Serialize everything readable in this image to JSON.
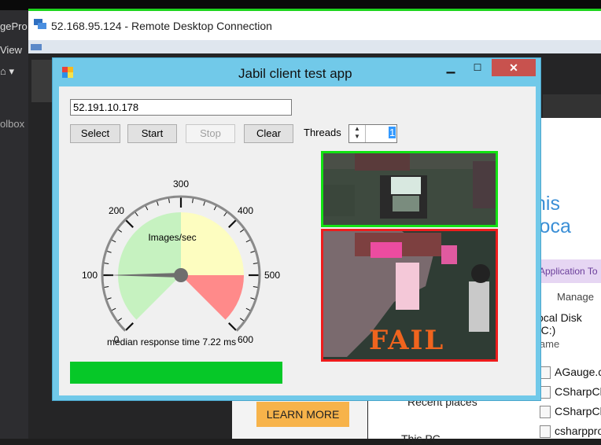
{
  "vs_left": {
    "frag1": "gePro",
    "frag2": "View",
    "frag3": "olbox"
  },
  "rdc": {
    "title": "52.168.95.124 - Remote Desktop Connection"
  },
  "explorer": {
    "heading": "his loca",
    "app_tools": "Application To",
    "manage": "Manage",
    "local_disk": "ocal Disk (C:)",
    "col_name": "lame",
    "files": [
      "AGauge.c",
      "CSharpCl",
      "CSharpCl",
      "csharppro"
    ],
    "recent_places": "Recent places",
    "this_pc": "This PC",
    "learn_more": "LEARN MORE"
  },
  "app": {
    "title": "Jabil client test app",
    "ip_value": "52.191.10.178",
    "buttons": {
      "select": "Select",
      "start": "Start",
      "stop": "Stop",
      "clear": "Clear"
    },
    "threads_label": "Threads",
    "threads_value": "1",
    "gauge": {
      "caption": "Images/sec",
      "min": 0,
      "max": 600,
      "value": 100,
      "labels": [
        "0",
        "100",
        "200",
        "300",
        "400",
        "500",
        "600"
      ],
      "zones": [
        {
          "from": 0,
          "to": 300,
          "color": "#c6f2c0"
        },
        {
          "from": 300,
          "to": 500,
          "color": "#fdfdc0"
        },
        {
          "from": 500,
          "to": 600,
          "color": "#ff8a8a"
        }
      ]
    },
    "median_label": "median response time",
    "median_value": "7.22 ms",
    "progress": 1.0,
    "progress_color": "#06c828",
    "image_top_border": "#12e212",
    "image_bottom_border": "#ee1c1c",
    "fail_text": "FAIL"
  }
}
